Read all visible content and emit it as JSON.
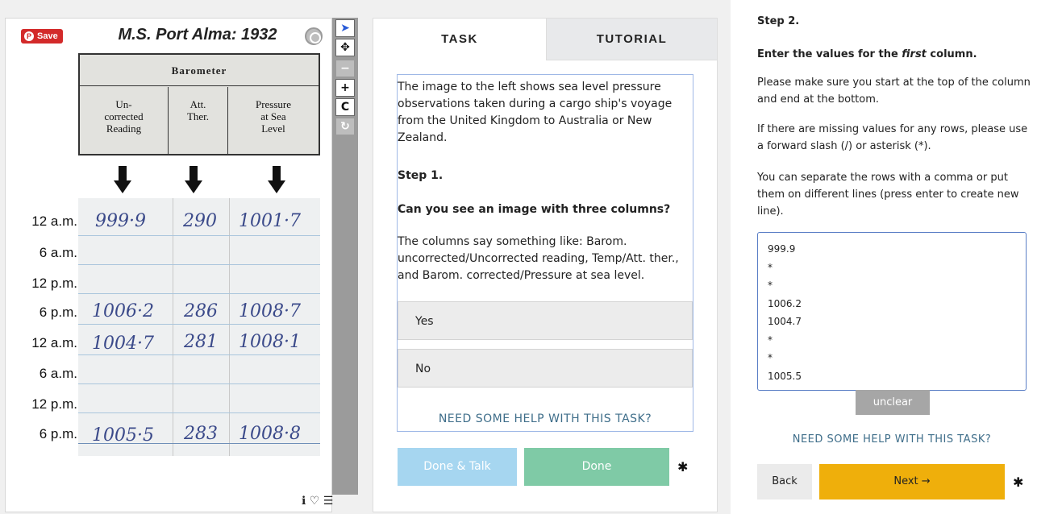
{
  "image_panel": {
    "save_label": "Save",
    "title": "M.S. Port Alma: 1932",
    "barometer_header": "Barometer",
    "columns": [
      "Un-\ncorrected\nReading",
      "Att.\nTher.",
      "Pressure\nat Sea\nLevel"
    ],
    "rows": [
      {
        "label": "12 a.m.",
        "c1": "999·9",
        "c2": "290",
        "c3": "1001·7"
      },
      {
        "label": "6 a.m.",
        "c1": "",
        "c2": "",
        "c3": ""
      },
      {
        "label": "12 p.m.",
        "c1": "",
        "c2": "",
        "c3": ""
      },
      {
        "label": "6 p.m.",
        "c1": "1006·2",
        "c2": "286",
        "c3": "1008·7"
      },
      {
        "label": "12 a.m.",
        "c1": "1004·7",
        "c2": "281",
        "c3": "1008·1"
      },
      {
        "label": "6 a.m.",
        "c1": "",
        "c2": "",
        "c3": ""
      },
      {
        "label": "12 p.m.",
        "c1": "",
        "c2": "",
        "c3": ""
      },
      {
        "label": "6 p.m.",
        "c1": "1005·5",
        "c2": "283",
        "c3": "1008·8"
      }
    ]
  },
  "toolbar": {
    "select": "➤",
    "move": "✥",
    "zoom_out": "−",
    "zoom_in": "+",
    "rotate": "C",
    "reset": "↻"
  },
  "bottom_icons": {
    "info": "ℹ",
    "favorite": "♡",
    "collections": "☰"
  },
  "task_panel": {
    "tab_task": "TASK",
    "tab_tutorial": "TUTORIAL",
    "intro": "The image to the left shows sea level pressure observations taken during a cargo ship's voyage from the United Kingdom to Australia or New Zealand.",
    "step_label": "Step 1.",
    "question": "Can you see an image with three columns?",
    "hint": "The columns say something like: Barom. uncorrected/Uncorrected reading, Temp/Att. ther., and Barom. corrected/Pressure at sea level.",
    "answer_yes": "Yes",
    "answer_no": "No",
    "help_link": "NEED SOME HELP WITH THIS TASK?",
    "done_talk_label": "Done & Talk",
    "done_label": "Done"
  },
  "step2_panel": {
    "step_label": "Step 2.",
    "instruction_prefix": "Enter the values for the ",
    "instruction_em": "first",
    "instruction_suffix": " column.",
    "p1": "Please make sure you start at the top of the column and end at the bottom.",
    "p2": "If there are missing values for any rows, please use a forward slash (/) or asterisk (*).",
    "p3": "You can separate the rows with a comma or put them on different lines (press enter to create new line).",
    "answer_value": "999.9\n*\n*\n1006.2\n1004.7\n*\n*\n1005.5",
    "unclear_label": "unclear",
    "help_link": "NEED SOME HELP WITH THIS TASK?",
    "back_label": "Back",
    "next_label": "Next →"
  },
  "colors": {
    "save_red": "#d32a2a",
    "ink_blue": "#3b4a8a",
    "done_green": "#7fcaa6",
    "done_talk_blue": "#a6d6f0",
    "next_yellow": "#efaf0b",
    "help_link": "#3f6e8a"
  }
}
